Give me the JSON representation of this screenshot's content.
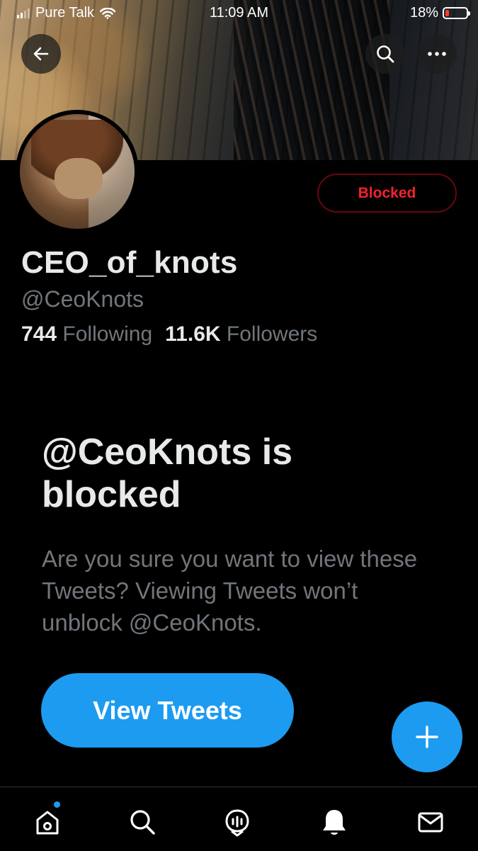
{
  "status_bar": {
    "carrier": "Pure Talk",
    "time": "11:09 AM",
    "battery": "18%",
    "battery_level": 0.18,
    "icons": [
      "signal-icon",
      "wifi-icon",
      "battery-icon"
    ]
  },
  "header": {
    "back_icon": "arrow-left-icon",
    "search_icon": "search-icon",
    "more_icon": "more-horizontal-icon"
  },
  "profile": {
    "display_name": "CEO_of_knots",
    "handle": "@CeoKnots",
    "following_count": "744",
    "following_label": "Following",
    "followers_count": "11.6K",
    "followers_label": "Followers",
    "blocked_button_label": "Blocked"
  },
  "blocked_notice": {
    "title": "@CeoKnots is blocked",
    "body": "Are you sure you want to view these Tweets? Viewing Tweets won’t unblock @CeoKnots.",
    "button_label": "View Tweets"
  },
  "fab": {
    "icon": "plus-icon"
  },
  "tab_bar": {
    "items": [
      {
        "icon": "home-icon",
        "has_badge": true
      },
      {
        "icon": "search-icon"
      },
      {
        "icon": "spaces-icon"
      },
      {
        "icon": "bell-icon"
      },
      {
        "icon": "mail-icon"
      }
    ]
  },
  "colors": {
    "accent": "#1d9bf0",
    "blocked_red": "#f4212e",
    "background": "#000000",
    "muted_text": "#71767b"
  }
}
